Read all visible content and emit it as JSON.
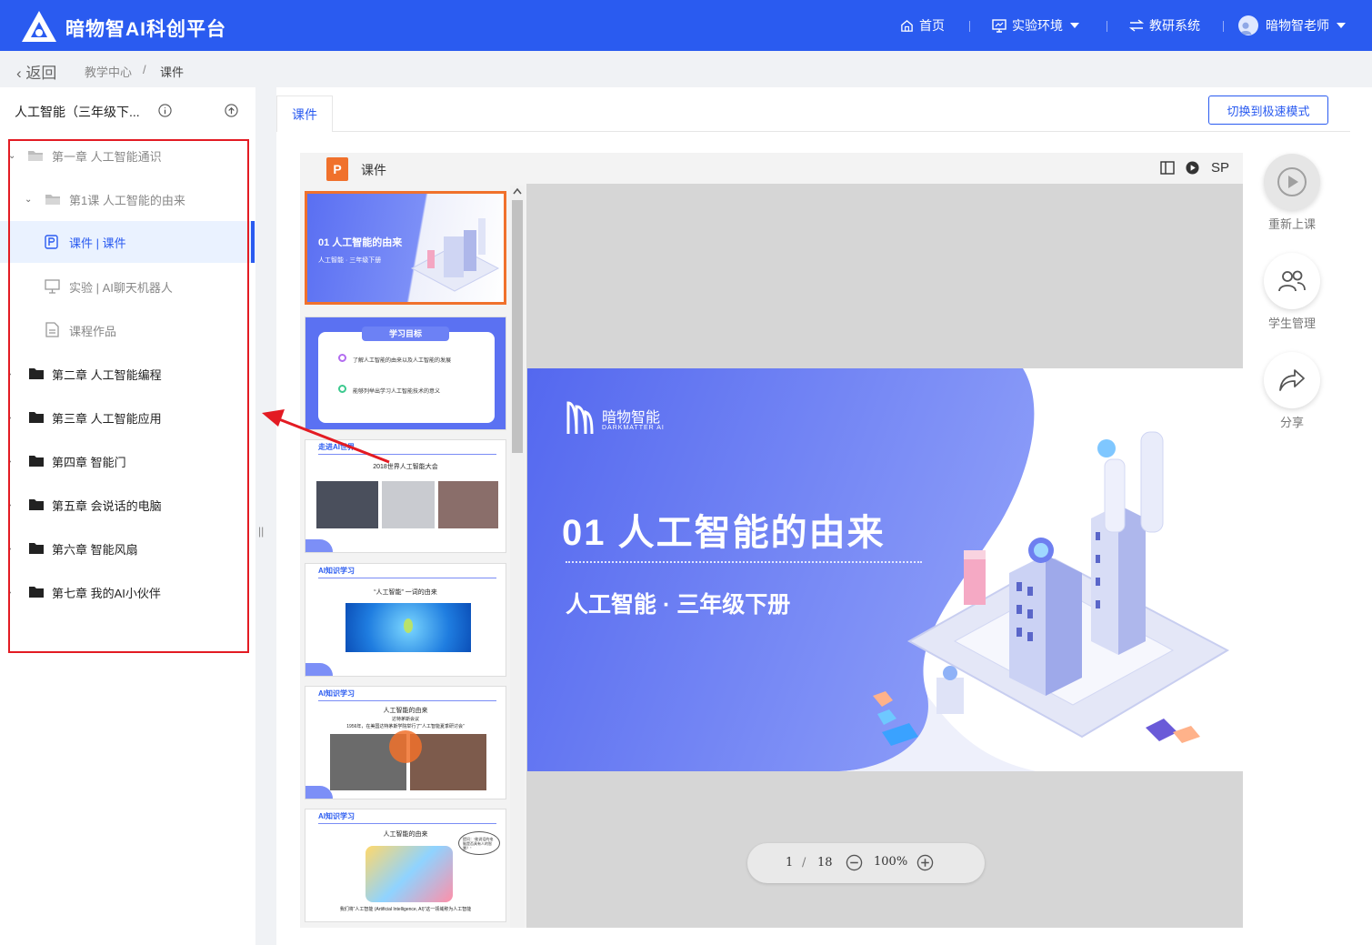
{
  "header": {
    "brand": "暗物智AI科创平台",
    "nav": {
      "home": "首页",
      "lab": "实验环境",
      "research": "教研系统",
      "user": "暗物智老师"
    }
  },
  "breadcrumb": {
    "back": "返回",
    "items": [
      "教学中心",
      "课件"
    ],
    "separator": "/"
  },
  "sidebar": {
    "course_title": "人工智能（三年级下...",
    "tree": [
      {
        "label": "第一章 人工智能通识"
      },
      {
        "label": "第1课 人工智能的由来"
      },
      {
        "label": "课件 | 课件"
      },
      {
        "label": "实验 | AI聊天机器人"
      },
      {
        "label": "课程作品"
      },
      {
        "label": "第二章 人工智能编程"
      },
      {
        "label": "第三章 人工智能应用"
      },
      {
        "label": "第四章 智能门"
      },
      {
        "label": "第五章 会说话的电脑"
      },
      {
        "label": "第六章 智能风扇"
      },
      {
        "label": "第七章 我的AI小伙伴"
      }
    ]
  },
  "main": {
    "tab": "课件",
    "speed_mode_button": "切换到极速模式",
    "viewer": {
      "title": "课件",
      "sp": "SP",
      "icon_letter": "P"
    },
    "thumbnails": {
      "t1": {
        "title": "01 人工智能的由来",
        "sub": "人工智能 · 三年级下册"
      },
      "t2": {
        "header": "学习目标",
        "line1": "了解人工智能的由来以及人工智能的发展",
        "line2": "能够列举出学习人工智能技术的意义"
      },
      "t3": {
        "header": "走进AI世界",
        "title": "2018世界人工智能大会"
      },
      "t4": {
        "header": "AI知识学习",
        "title": "“人工智能” 一词的由来"
      },
      "t5": {
        "header": "AI知识学习",
        "title": "人工智能的由来",
        "sub1": "达特茅斯会议",
        "sub2": "1956年，在美国达特茅斯学院举行了“人工智能夏季研讨会”"
      },
      "t6": {
        "header": "AI知识学习",
        "title": "人工智能的由来",
        "bubble": "提问：“能说话的电脑是否具有人的智慧？”",
        "caption": "我们将“人工智能 (Artificial Intelligence, AI)”这一领域称为人工智能"
      }
    },
    "slide": {
      "logo_cn": "暗物智能",
      "logo_en": "DARKMATTER AI",
      "title": "01 人工智能的由来",
      "subtitle": "人工智能 · 三年级下册"
    },
    "pager": {
      "current": "1",
      "separator": "/",
      "total": "18",
      "zoom": "100%"
    }
  },
  "right_actions": {
    "restart": "重新上课",
    "students": "学生管理",
    "share": "分享"
  },
  "colors": {
    "primary": "#2a5bf0",
    "ppt_orange": "#f0712c",
    "annotation_red": "#e31b23"
  }
}
